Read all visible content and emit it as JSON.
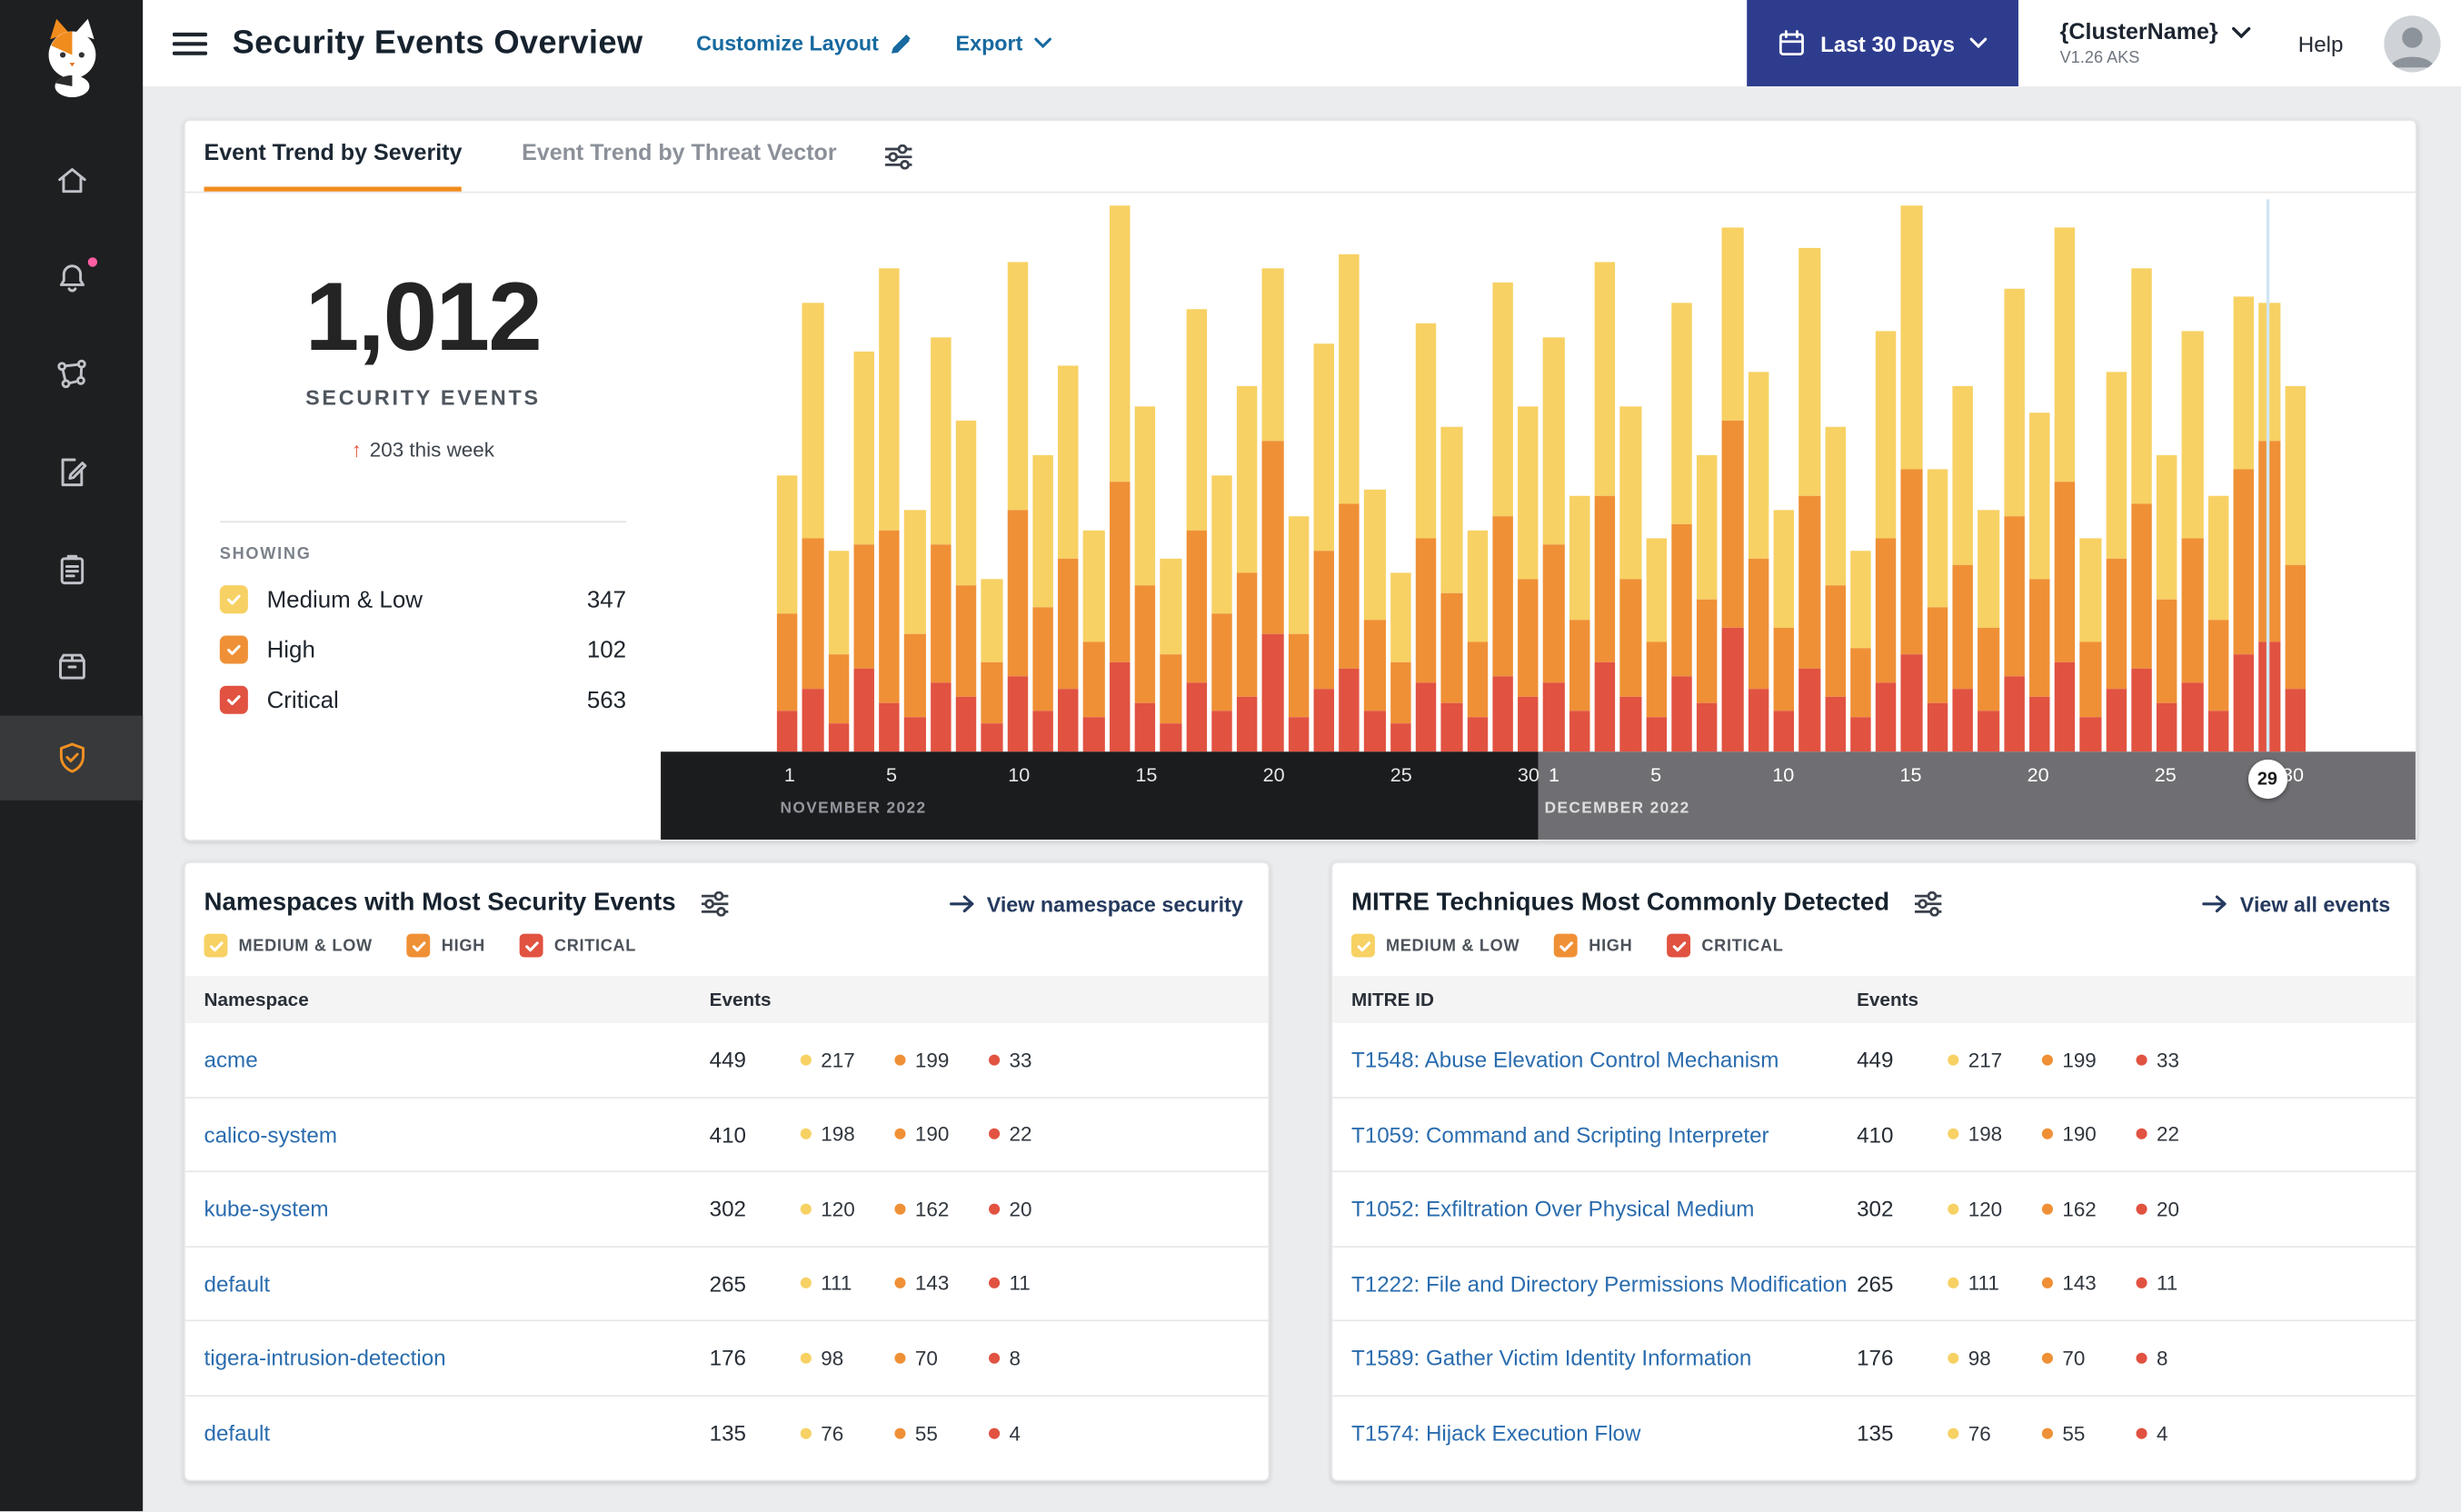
{
  "header": {
    "title": "Security Events Overview",
    "customize_layout": "Customize Layout",
    "export_label": "Export",
    "date_range": "Last 30 Days",
    "cluster_name": "{ClusterName}",
    "cluster_version": "V1.26 AKS",
    "help_label": "Help"
  },
  "tabs": {
    "severity": "Event Trend by Severity",
    "threat_vector": "Event Trend by Threat Vector"
  },
  "summary": {
    "total": "1,012",
    "total_label": "SECURITY EVENTS",
    "delta_arrow": "↑",
    "delta_text": "203 this week",
    "showing_label": "SHOWING",
    "legend": [
      {
        "label": "Medium & Low",
        "value": "347",
        "color": "#F7D163"
      },
      {
        "label": "High",
        "value": "102",
        "color": "#EF9036"
      },
      {
        "label": "Critical",
        "value": "563",
        "color": "#E15241"
      }
    ]
  },
  "chart_data": {
    "type": "bar",
    "stacked": true,
    "stack_order": "bottom-to-top",
    "ylim": [
      0,
      80
    ],
    "grid": false,
    "months": [
      {
        "label": "NOVEMBER 2022",
        "ticks": [
          "1",
          "5",
          "10",
          "15",
          "20",
          "25",
          "30"
        ]
      },
      {
        "label": "DECEMBER 2022",
        "ticks": [
          "1",
          "5",
          "10",
          "15",
          "20",
          "25",
          "30"
        ]
      }
    ],
    "days_per_month": 30,
    "current_day": {
      "label": "29",
      "index": 58
    },
    "series": [
      {
        "name": "Critical",
        "color": "#E15241",
        "values": [
          6,
          9,
          4,
          12,
          7,
          5,
          10,
          8,
          4,
          11,
          6,
          9,
          5,
          13,
          7,
          4,
          10,
          6,
          8,
          17,
          5,
          9,
          12,
          6,
          4,
          10,
          7,
          5,
          11,
          8,
          10,
          6,
          13,
          8,
          5,
          11,
          7,
          18,
          9,
          6,
          12,
          8,
          5,
          10,
          14,
          7,
          9,
          6,
          11,
          8,
          13,
          5,
          9,
          12,
          7,
          10,
          6,
          14,
          16,
          9
        ]
      },
      {
        "name": "High",
        "color": "#EF9036",
        "values": [
          14,
          22,
          10,
          18,
          25,
          12,
          20,
          16,
          9,
          24,
          15,
          19,
          11,
          26,
          17,
          10,
          22,
          14,
          18,
          28,
          12,
          20,
          24,
          13,
          9,
          21,
          16,
          11,
          23,
          17,
          20,
          13,
          24,
          17,
          11,
          22,
          15,
          30,
          19,
          12,
          25,
          16,
          10,
          21,
          27,
          14,
          18,
          12,
          23,
          17,
          26,
          11,
          19,
          24,
          15,
          21,
          13,
          27,
          29,
          18
        ]
      },
      {
        "name": "Medium & Low",
        "color": "#F7D163",
        "values": [
          20,
          34,
          15,
          28,
          38,
          18,
          30,
          24,
          12,
          36,
          22,
          28,
          16,
          40,
          26,
          14,
          32,
          20,
          27,
          25,
          17,
          30,
          36,
          19,
          13,
          31,
          24,
          16,
          34,
          25,
          30,
          18,
          34,
          25,
          15,
          32,
          21,
          28,
          27,
          17,
          36,
          23,
          14,
          30,
          38,
          20,
          26,
          17,
          33,
          24,
          37,
          15,
          27,
          34,
          21,
          30,
          18,
          25,
          20,
          26
        ]
      }
    ]
  },
  "namespaces_card": {
    "title": "Namespaces with Most Security Events",
    "action": "View namespace security",
    "columns": [
      "Namespace",
      "Events"
    ],
    "filters": [
      {
        "label": "MEDIUM & LOW",
        "color": "#F7D163"
      },
      {
        "label": "HIGH",
        "color": "#EF9036"
      },
      {
        "label": "CRITICAL",
        "color": "#E15241"
      }
    ],
    "rows": [
      {
        "name": "acme",
        "events": "449",
        "medium_low": "217",
        "high": "199",
        "critical": "33"
      },
      {
        "name": "calico-system",
        "events": "410",
        "medium_low": "198",
        "high": "190",
        "critical": "22"
      },
      {
        "name": "kube-system",
        "events": "302",
        "medium_low": "120",
        "high": "162",
        "critical": "20"
      },
      {
        "name": "default",
        "events": "265",
        "medium_low": "111",
        "high": "143",
        "critical": "11"
      },
      {
        "name": "tigera-intrusion-detection",
        "events": "176",
        "medium_low": "98",
        "high": "70",
        "critical": "8"
      },
      {
        "name": "default",
        "events": "135",
        "medium_low": "76",
        "high": "55",
        "critical": "4"
      }
    ]
  },
  "mitre_card": {
    "title": "MITRE Techniques Most Commonly Detected",
    "action": "View all events",
    "columns": [
      "MITRE ID",
      "Events"
    ],
    "filters": [
      {
        "label": "MEDIUM & LOW",
        "color": "#F7D163"
      },
      {
        "label": "HIGH",
        "color": "#EF9036"
      },
      {
        "label": "CRITICAL",
        "color": "#E15241"
      }
    ],
    "rows": [
      {
        "name": "T1548: Abuse Elevation Control Mechanism",
        "events": "449",
        "medium_low": "217",
        "high": "199",
        "critical": "33"
      },
      {
        "name": "T1059: Command and Scripting Interpreter",
        "events": "410",
        "medium_low": "198",
        "high": "190",
        "critical": "22"
      },
      {
        "name": "T1052: Exfiltration Over Physical Medium",
        "events": "302",
        "medium_low": "120",
        "high": "162",
        "critical": "20"
      },
      {
        "name": "T1222: File and Directory Permissions Modification",
        "events": "265",
        "medium_low": "111",
        "high": "143",
        "critical": "11"
      },
      {
        "name": "T1589: Gather Victim Identity Information",
        "events": "176",
        "medium_low": "98",
        "high": "70",
        "critical": "8"
      },
      {
        "name": "T1574: Hijack Execution Flow",
        "events": "135",
        "medium_low": "76",
        "high": "55",
        "critical": "4"
      }
    ]
  }
}
